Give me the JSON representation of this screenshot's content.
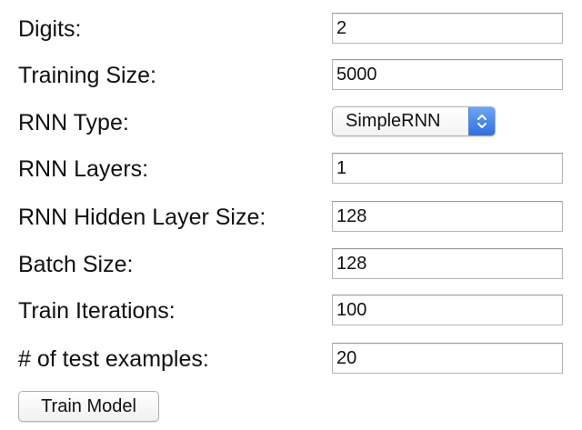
{
  "form": {
    "digits": {
      "label": "Digits:",
      "value": "2"
    },
    "training_size": {
      "label": "Training Size:",
      "value": "5000"
    },
    "rnn_type": {
      "label": "RNN Type:",
      "value": "SimpleRNN"
    },
    "rnn_layers": {
      "label": "RNN Layers:",
      "value": "1"
    },
    "rnn_hidden_layer_size": {
      "label": "RNN Hidden Layer Size:",
      "value": "128"
    },
    "batch_size": {
      "label": "Batch Size:",
      "value": "128"
    },
    "train_iterations": {
      "label": "Train Iterations:",
      "value": "100"
    },
    "test_examples": {
      "label": "# of test examples:",
      "value": "20"
    }
  },
  "actions": {
    "train_label": "Train Model"
  },
  "colors": {
    "stepper_accent": "#3b7be6"
  },
  "icons": {
    "rnn_type_stepper": "up-down-chevron-icon"
  }
}
